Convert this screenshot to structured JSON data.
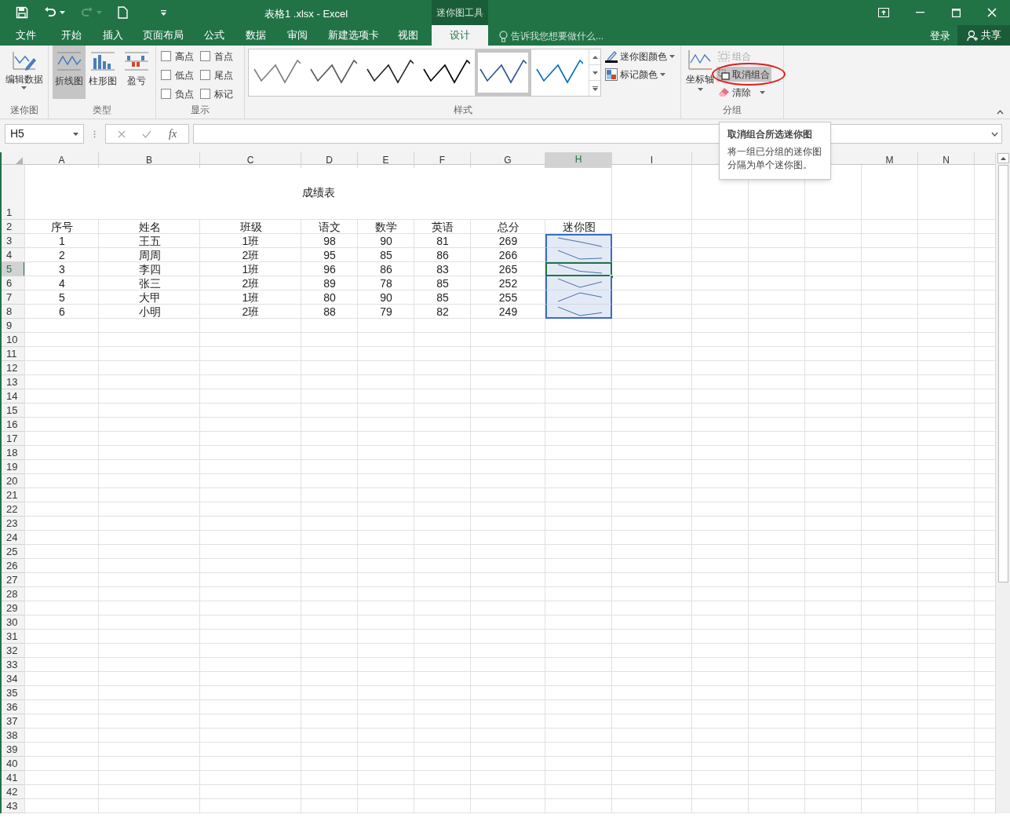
{
  "title_bar": {
    "title": "表格1 .xlsx - Excel",
    "context_label": "迷你图工具"
  },
  "tabs": [
    {
      "label": "文件",
      "selected": false
    },
    {
      "label": "开始",
      "selected": false
    },
    {
      "label": "插入",
      "selected": false
    },
    {
      "label": "页面布局",
      "selected": false
    },
    {
      "label": "公式",
      "selected": false
    },
    {
      "label": "数据",
      "selected": false
    },
    {
      "label": "审阅",
      "selected": false
    },
    {
      "label": "新建选项卡",
      "selected": false
    },
    {
      "label": "视图",
      "selected": false
    },
    {
      "label": "设计",
      "selected": true
    }
  ],
  "tell_me": {
    "placeholder": "告诉我您想要做什么..."
  },
  "account": {
    "sign_in": "登录",
    "share": "共享"
  },
  "ribbon": {
    "sparkline": {
      "label": "迷你图",
      "edit_data": "编辑数据"
    },
    "type": {
      "label": "类型",
      "buttons": [
        {
          "label": "折线图",
          "selected": true
        },
        {
          "label": "柱形图",
          "selected": false
        },
        {
          "label": "盈亏",
          "selected": false
        }
      ]
    },
    "show": {
      "label": "显示",
      "options": [
        {
          "label": "高点",
          "checked": false
        },
        {
          "label": "首点",
          "checked": false
        },
        {
          "label": "低点",
          "checked": false
        },
        {
          "label": "尾点",
          "checked": false
        },
        {
          "label": "负点",
          "checked": false
        },
        {
          "label": "标记",
          "checked": false
        }
      ]
    },
    "style": {
      "label": "样式",
      "gallery": [
        {
          "color": "#7f7f7f",
          "selected": false
        },
        {
          "color": "#595959",
          "selected": false
        },
        {
          "color": "#262626",
          "selected": false
        },
        {
          "color": "#000000",
          "selected": false
        },
        {
          "color": "#2f5597",
          "selected": true
        },
        {
          "color": "#0070c0",
          "selected": false
        }
      ],
      "sparkline_color": "迷你图颜色",
      "marker_color": "标记颜色"
    },
    "group": {
      "label": "分组",
      "axis": "坐标轴",
      "items": [
        {
          "label": "组合",
          "disabled": true,
          "hovered": false,
          "circled": false,
          "dropdown": false
        },
        {
          "label": "取消组合",
          "disabled": false,
          "hovered": true,
          "circled": true,
          "dropdown": false
        },
        {
          "label": "清除",
          "disabled": false,
          "hovered": false,
          "circled": false,
          "dropdown": true
        }
      ]
    }
  },
  "formula_bar": {
    "name_box": "H5",
    "function_button": "fx"
  },
  "tooltip": {
    "title": "取消组合所选迷你图",
    "text": "将一组已分组的迷你图分隔为单个迷你图。"
  },
  "sheet": {
    "columns": [
      {
        "label": "A",
        "selected": false
      },
      {
        "label": "B",
        "selected": false
      },
      {
        "label": "C",
        "selected": false
      },
      {
        "label": "D",
        "selected": false
      },
      {
        "label": "E",
        "selected": false
      },
      {
        "label": "F",
        "selected": false
      },
      {
        "label": "G",
        "selected": false
      },
      {
        "label": "H",
        "selected": true
      },
      {
        "label": "I",
        "selected": false
      },
      {
        "kind": "covered"
      },
      {
        "kind": "covered"
      },
      {
        "kind": "covered"
      },
      {
        "label": "M",
        "selected": false
      },
      {
        "label": "N",
        "selected": false
      }
    ],
    "title": "成绩表",
    "header": [
      "序号",
      "姓名",
      "班级",
      "语文",
      "数学",
      "英语",
      "总分",
      "迷你图"
    ],
    "rows": [
      {
        "cells": [
          "1",
          "王五",
          "1班",
          "98",
          "90",
          "81",
          "269"
        ],
        "in_selection": true,
        "active": false
      },
      {
        "cells": [
          "2",
          "周周",
          "2班",
          "95",
          "85",
          "86",
          "266"
        ],
        "in_selection": true,
        "active": false
      },
      {
        "cells": [
          "3",
          "李四",
          "1班",
          "96",
          "86",
          "83",
          "265"
        ],
        "in_selection": true,
        "active": true
      },
      {
        "cells": [
          "4",
          "张三",
          "2班",
          "89",
          "78",
          "85",
          "252"
        ],
        "in_selection": true,
        "active": false
      },
      {
        "cells": [
          "5",
          "大甲",
          "1班",
          "80",
          "90",
          "85",
          "255"
        ],
        "in_selection": true,
        "active": false
      },
      {
        "cells": [
          "6",
          "小明",
          "2班",
          "88",
          "79",
          "82",
          "249"
        ],
        "in_selection": true,
        "active": false
      }
    ],
    "row_headers": [
      {
        "label": "1",
        "selected": false
      },
      {
        "label": "2",
        "selected": false
      },
      {
        "label": "3",
        "selected": false
      },
      {
        "label": "4",
        "selected": false
      },
      {
        "label": "5",
        "selected": true
      },
      {
        "label": "6",
        "selected": false
      },
      {
        "label": "7",
        "selected": false
      },
      {
        "label": "8",
        "selected": false
      },
      {
        "label": "9",
        "selected": false
      },
      {
        "label": "10",
        "selected": false
      },
      {
        "label": "11",
        "selected": false
      },
      {
        "label": "12",
        "selected": false
      },
      {
        "label": "13",
        "selected": false
      },
      {
        "label": "14",
        "selected": false
      },
      {
        "label": "15",
        "selected": false
      },
      {
        "label": "16",
        "selected": false
      },
      {
        "label": "17",
        "selected": false
      },
      {
        "label": "18",
        "selected": false
      },
      {
        "label": "19",
        "selected": false
      },
      {
        "label": "20",
        "selected": false
      },
      {
        "label": "21",
        "selected": false
      },
      {
        "label": "22",
        "selected": false
      },
      {
        "label": "23",
        "selected": false
      },
      {
        "label": "24",
        "selected": false
      },
      {
        "label": "25",
        "selected": false
      },
      {
        "label": "26",
        "selected": false
      },
      {
        "label": "27",
        "selected": false
      },
      {
        "label": "28",
        "selected": false
      },
      {
        "label": "29",
        "selected": false
      },
      {
        "label": "30",
        "selected": false
      },
      {
        "label": "31",
        "selected": false
      },
      {
        "label": "32",
        "selected": false
      },
      {
        "label": "33",
        "selected": false
      },
      {
        "label": "34",
        "selected": false
      },
      {
        "label": "35",
        "selected": false
      },
      {
        "label": "36",
        "selected": false
      },
      {
        "label": "37",
        "selected": false
      },
      {
        "label": "38",
        "selected": false
      },
      {
        "label": "39",
        "selected": false
      },
      {
        "label": "40",
        "selected": false
      },
      {
        "label": "41",
        "selected": false
      },
      {
        "label": "42",
        "selected": false
      },
      {
        "label": "43",
        "selected": false
      }
    ]
  }
}
